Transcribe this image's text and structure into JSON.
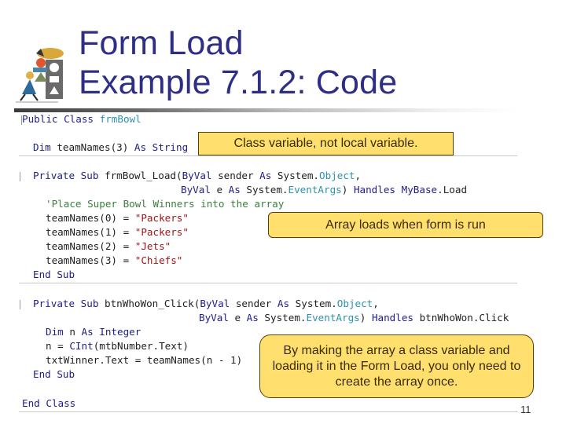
{
  "slide": {
    "title_line1": "Form Load",
    "title_line2": "Example 7.1.2: Code",
    "page_number": "11",
    "logo_icon": "child-stacking-shapes-icon"
  },
  "code": {
    "class_open": {
      "kw1": "Public",
      "kw2": "Class",
      "name": "frmBowl"
    },
    "dim_line": {
      "kw1": "Dim",
      "text1": " teamNames(3) ",
      "kw2": "As",
      "kw3": "String"
    },
    "load_sub": {
      "line1": {
        "kw1": "Private",
        "kw2": "Sub",
        "name": " frmBowl_Load(",
        "kw3": "ByVal",
        "t1": " sender ",
        "kw4": "As",
        "t2": " System.",
        "ty": "Object",
        "t3": ","
      },
      "line2": {
        "kw1": "ByVal",
        "t1": " e ",
        "kw2": "As",
        "t2": " System.",
        "ty": "EventArgs",
        "t3": ") ",
        "kw3": "Handles",
        "kw4": "MyBase",
        "t4": ".Load"
      },
      "comment": "'Place Super Bowl Winners into the array",
      "assignments": [
        {
          "lhs": "teamNames(0) = ",
          "value": "\"Packers\""
        },
        {
          "lhs": "teamNames(1) = ",
          "value": "\"Packers\""
        },
        {
          "lhs": "teamNames(2) = ",
          "value": "\"Jets\""
        },
        {
          "lhs": "teamNames(3) = ",
          "value": "\"Chiefs\""
        }
      ],
      "end": "End Sub"
    },
    "click_sub": {
      "line1": {
        "kw1": "Private",
        "kw2": "Sub",
        "name": " btnWhoWon_Click(",
        "kw3": "ByVal",
        "t1": " sender ",
        "kw4": "As",
        "t2": " System.",
        "ty": "Object",
        "t3": ","
      },
      "line2": {
        "kw1": "ByVal",
        "t1": " e ",
        "kw2": "As",
        "t2": " System.",
        "ty": "EventArgs",
        "t3": ") ",
        "kw3": "Handles",
        "t4": " btnWhoWon.Click"
      },
      "dim": {
        "kw1": "Dim",
        "t1": " n ",
        "kw2": "As",
        "kw3": "Integer"
      },
      "assign_n": {
        "t1": "n = ",
        "kw": "CInt",
        "t2": "(mtbNumber.Text)"
      },
      "assign_winner": "txtWinner.Text = teamNames(n - 1)",
      "end": "End Sub"
    },
    "class_close": "End Class"
  },
  "callouts": {
    "class_variable": "Class variable, not local variable.",
    "array_loads": "Array loads when form is run",
    "explanation": "By making the array a class variable and loading it in the Form Load, you only need to create the array once."
  },
  "colors": {
    "title": "#2e2e86",
    "callout_fill": "#ffe06e",
    "callout_border": "#5a4000",
    "keyword": "#1d1d8a",
    "type": "#2b91af",
    "comment": "#3a7f3a",
    "string": "#a31515"
  }
}
